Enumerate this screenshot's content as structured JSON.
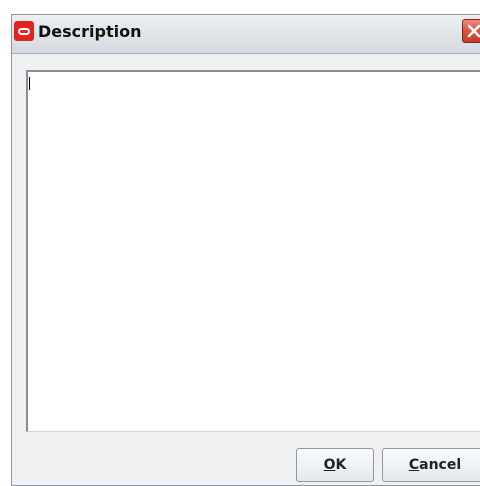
{
  "window": {
    "title": "Description",
    "icon": "oracle-icon",
    "close_icon": "close-icon",
    "accent": "#e32222"
  },
  "description_field": {
    "value": "",
    "placeholder": ""
  },
  "buttons": {
    "ok": {
      "mnemonic": "O",
      "rest": "K"
    },
    "cancel": {
      "mnemonic": "C",
      "rest": "ancel"
    }
  }
}
